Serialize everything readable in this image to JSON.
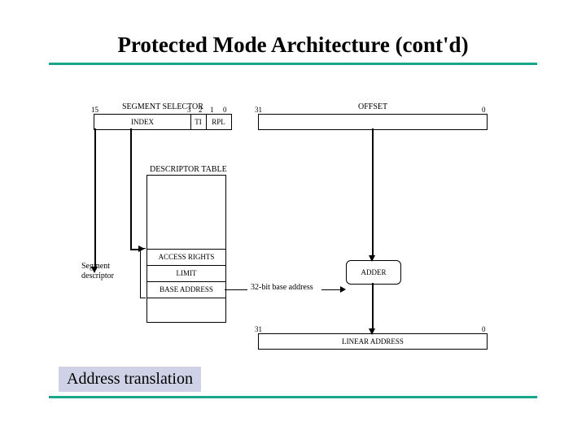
{
  "title": "Protected Mode Architecture (cont'd)",
  "caption": "Address translation",
  "selector": {
    "title": "SEGMENT SELECTOR",
    "bits": {
      "hi": "15",
      "b3": "3",
      "b2": "2",
      "b1": "1",
      "b0": "0"
    },
    "fields": {
      "index": "INDEX",
      "ti": "TI",
      "rpl": "RPL"
    }
  },
  "offset": {
    "title": "OFFSET",
    "bits": {
      "hi": "31",
      "lo": "0"
    }
  },
  "descriptor_table": {
    "title": "DESCRIPTOR TABLE",
    "rows": {
      "access": "ACCESS  RIGHTS",
      "limit": "LIMIT",
      "base": "BASE ADDRESS"
    },
    "side_label_l1": "Segment",
    "side_label_l2": "descriptor"
  },
  "base_label": "32-bit base address",
  "adder": "ADDER",
  "linear": {
    "title": "LINEAR ADDRESS",
    "bits": {
      "hi": "31",
      "lo": "0"
    }
  }
}
